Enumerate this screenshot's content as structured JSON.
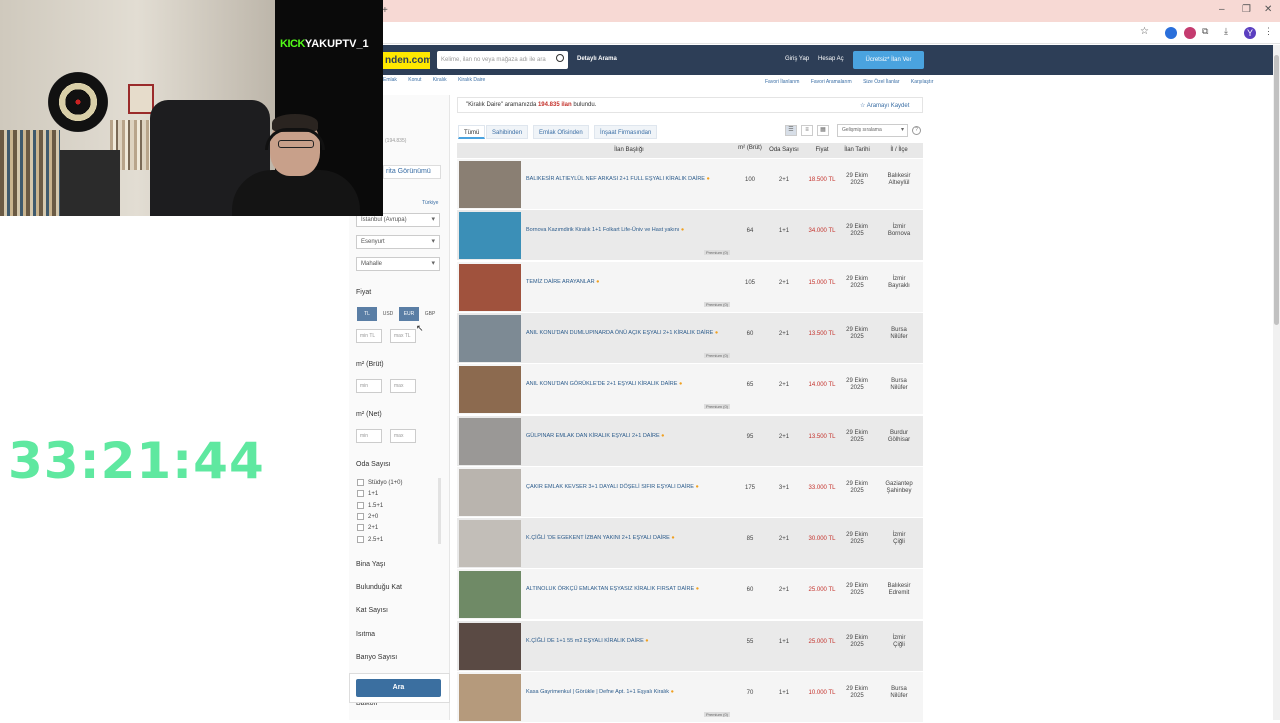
{
  "browser": {
    "window_controls": [
      "–",
      "❐",
      "✕"
    ],
    "toolbar_icons": [
      "star-icon",
      "extension-icon",
      "extension-icon-2",
      "puzzle-icon",
      "download-icon",
      "profile-avatar",
      "menu-icon"
    ],
    "tab_plus": "+",
    "profile_initial": "Y"
  },
  "stream": {
    "channel": "YAKUPTV_1",
    "platform": "KICK",
    "timer": "33:21:44"
  },
  "site_header": {
    "logo": "nden.com",
    "search_placeholder": "Kelime, ilan no veya mağaza adı ile ara",
    "detailed_search": "Detaylı Arama",
    "login": "Giriş Yap",
    "register": "Hesap Aç",
    "post_ad": "Ücretsiz* İlan Ver"
  },
  "breadcrumb": [
    "Emlak",
    "Konut",
    "Kiralık",
    "Kiralık Daire"
  ],
  "sublinks": [
    "Favori İlanlarım",
    "Favori Aramalarım",
    "Size Özel İlanlar",
    "Karşılaştır"
  ],
  "filters": {
    "count_hint": "(194.835)",
    "map_view": "rita Görünümü",
    "country": "Türkiye",
    "city": "İstanbul (Avrupa)",
    "district": "Esenyurt",
    "neighborhood": "Mahalle",
    "price_label": "Fiyat",
    "currencies": [
      "TL",
      "USD",
      "EUR",
      "GBP"
    ],
    "selected_currency": "EUR",
    "price_min": "min TL",
    "price_max": "max TL",
    "m2_gross_label": "m² (Brüt)",
    "m2_net_label": "m² (Net)",
    "min": "min",
    "max": "max",
    "rooms_label": "Oda Sayısı",
    "rooms": [
      "Stüdyo (1+0)",
      "1+1",
      "1.5+1",
      "2+0",
      "2+1",
      "2.5+1"
    ],
    "collapsibles": [
      "Bina Yaşı",
      "Bulunduğu Kat",
      "Kat Sayısı",
      "Isıtma",
      "Banyo Sayısı",
      "Balkon"
    ],
    "search_button": "Ara"
  },
  "results": {
    "summary_prefix": "\"Kiralık Daire\" aramanızda",
    "summary_count": "194.835 ilan",
    "summary_suffix": "bulundu.",
    "save_search": "☆ Aramayı Kaydet",
    "tabs": [
      "Tümü",
      "Sahibinden",
      "Emlak Ofisinden",
      "İnşaat Firmasından"
    ],
    "sort": "Gelişmiş sıralama",
    "columns": [
      "İlan Başlığı",
      "m² (Brüt)",
      "Oda Sayısı",
      "Fiyat",
      "İlan Tarihi",
      "İl / İlçe"
    ],
    "listings": [
      {
        "title": "BALIKESİR ALTIEYLÜL NEF ARKASI 2+1 FULL EŞYALI KİRALIK DAİRE",
        "m2": "100",
        "rooms": "2+1",
        "price": "18.500 TL",
        "date1": "29 Ekim",
        "date2": "2025",
        "loc1": "Balıkesir",
        "loc2": "Altıeylül",
        "badge": "",
        "thumb": "#8a7f73"
      },
      {
        "title": "Bornova Kazımdirik Kiralık 1+1 Folkart Life-Üniv ve Hast yakını",
        "m2": "64",
        "rooms": "1+1",
        "price": "34.000 TL",
        "date1": "29 Ekim",
        "date2": "2025",
        "loc1": "İzmir",
        "loc2": "Bornova",
        "badge": "Premium (0)",
        "thumb": "#3b8fb7"
      },
      {
        "title": "TEMİZ DAİRE ARAYANLAR",
        "m2": "105",
        "rooms": "2+1",
        "price": "15.000 TL",
        "date1": "29 Ekim",
        "date2": "2025",
        "loc1": "İzmir",
        "loc2": "Bayraklı",
        "badge": "Premium (0)",
        "thumb": "#a0523d"
      },
      {
        "title": "ANIL KONU'DAN DUMLUPINARDA ÖNÜ AÇIK EŞYALI 2+1 KİRALIK DAİRE",
        "m2": "60",
        "rooms": "2+1",
        "price": "13.500 TL",
        "date1": "29 Ekim",
        "date2": "2025",
        "loc1": "Bursa",
        "loc2": "Nilüfer",
        "badge": "Premium (0)",
        "thumb": "#7d8a94"
      },
      {
        "title": "ANIL KONU'DAN GÖRÜKLE'DE 2+1 EŞYALI KİRALIK DAİRE",
        "m2": "65",
        "rooms": "2+1",
        "price": "14.000 TL",
        "date1": "29 Ekim",
        "date2": "2025",
        "loc1": "Bursa",
        "loc2": "Nilüfer",
        "badge": "Premium (0)",
        "thumb": "#8c6a4f"
      },
      {
        "title": "GÜLPINAR EMLAK DAN KİRALIK EŞYALI 2+1 DAİRE",
        "m2": "95",
        "rooms": "2+1",
        "price": "13.500 TL",
        "date1": "29 Ekim",
        "date2": "2025",
        "loc1": "Burdur",
        "loc2": "Gölhisar",
        "badge": "",
        "thumb": "#9a9896"
      },
      {
        "title": "ÇAKIR EMLAK KEVSER 3+1 DAYALI DÖŞELİ SIFIR EŞYALI DAİRE",
        "m2": "175",
        "rooms": "3+1",
        "price": "33.000 TL",
        "date1": "29 Ekim",
        "date2": "2025",
        "loc1": "Gaziantep",
        "loc2": "Şahinbey",
        "badge": "",
        "thumb": "#b9b4ae"
      },
      {
        "title": "K.ÇİĞLİ 'DE EGEKENT İZBAN YAKINI 2+1 EŞYALI DAİRE",
        "m2": "85",
        "rooms": "2+1",
        "price": "30.000 TL",
        "date1": "29 Ekim",
        "date2": "2025",
        "loc1": "İzmir",
        "loc2": "Çiğli",
        "badge": "",
        "thumb": "#c2beb8"
      },
      {
        "title": "ALTINOLUK ÖRKÇÜ EMLAKTAN EŞYASIZ KİRALIK FIRSAT DAİRE",
        "m2": "60",
        "rooms": "2+1",
        "price": "25.000 TL",
        "date1": "29 Ekim",
        "date2": "2025",
        "loc1": "Balıkesir",
        "loc2": "Edremit",
        "badge": "",
        "thumb": "#6f8a66"
      },
      {
        "title": "K.ÇİĞLİ DE 1+1 55 m2 EŞYALI KİRALIK DAİRE",
        "m2": "55",
        "rooms": "1+1",
        "price": "25.000 TL",
        "date1": "29 Ekim",
        "date2": "2025",
        "loc1": "İzmir",
        "loc2": "Çiğli",
        "badge": "",
        "thumb": "#5a4a44"
      },
      {
        "title": "Kasa Gayrimenkul | Görükle | Defne Apt. 1+1 Eşyalı Kiralık",
        "m2": "70",
        "rooms": "1+1",
        "price": "10.000 TL",
        "date1": "29 Ekim",
        "date2": "2025",
        "loc1": "Bursa",
        "loc2": "Nilüfer",
        "badge": "Premium (0)",
        "thumb": "#b59a7c"
      }
    ]
  }
}
